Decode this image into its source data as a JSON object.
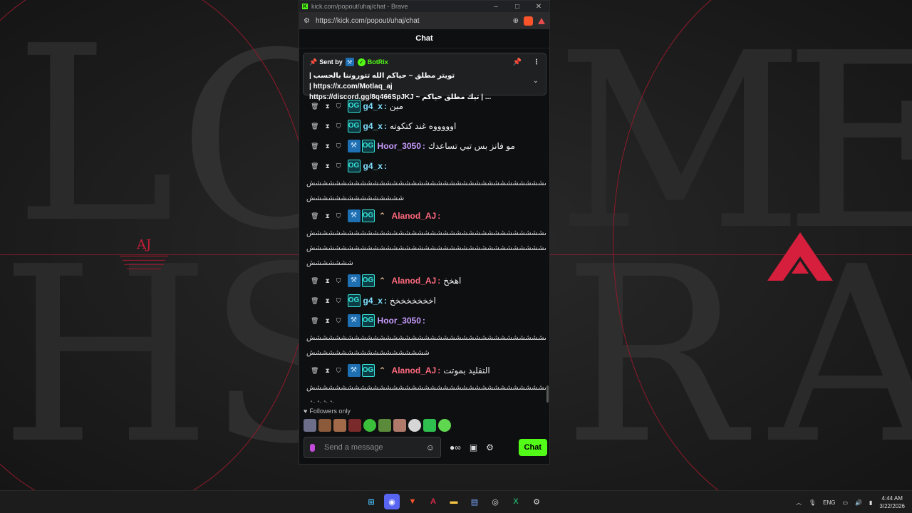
{
  "browser": {
    "title": "kick.com/popout/uhaj/chat - Brave",
    "url": "https://kick.com/popout/uhaj/chat"
  },
  "chat": {
    "header": "Chat",
    "pinned": {
      "sent_by_label": "Sent by",
      "sender": "BotRix",
      "line1": "تويتر مطلق ~ حياكم الله تتوروننا بالحسب | https://x.com/Motlaq_aj |",
      "line2": "https://discord.gg/8q466SpJKJ ~ تيك مطلق حياكم | ..."
    },
    "messages": [
      {
        "user": "g4_x",
        "color": "teal",
        "badges": [
          "vip"
        ],
        "text": "مين",
        "wrap": []
      },
      {
        "user": "g4_x",
        "color": "teal",
        "badges": [
          "vip"
        ],
        "text": "اوووووه غند كتكوته",
        "wrap": []
      },
      {
        "user": "Hoor_3050",
        "color": "purple",
        "badges": [
          "mod",
          "vip"
        ],
        "text": "مو فانز بس تبي تساعدك",
        "wrap": []
      },
      {
        "user": "g4_x",
        "color": "teal",
        "badges": [
          "vip"
        ],
        "text": "",
        "wrap": [
          "ششششششششششششششششششششششششششششششششششششششششششششششششش",
          "ششششششششششششششش"
        ]
      },
      {
        "user": "Alanod_AJ",
        "color": "pink",
        "badges": [
          "mod",
          "vip",
          "og"
        ],
        "text": "",
        "wrap": [
          "ششششششششششششششششششششششششششششششششششششششششششششششششش",
          "ششششششششششششششششششششششششششششششششششششششششششششششششش",
          "ششششششش"
        ]
      },
      {
        "user": "Alanod_AJ",
        "color": "pink",
        "badges": [
          "mod",
          "vip",
          "og"
        ],
        "text": "اهخخ",
        "wrap": []
      },
      {
        "user": "g4_x",
        "color": "teal",
        "badges": [
          "vip"
        ],
        "text": "اخخخخخخخخ",
        "wrap": []
      },
      {
        "user": "Hoor_3050",
        "color": "purple",
        "badges": [
          "mod",
          "vip"
        ],
        "text": "",
        "wrap": [
          "ششششششششششششششششششششششششششششششششششششششششششششششششش",
          "ششششششششششششششششششش"
        ]
      },
      {
        "user": "Alanod_AJ",
        "color": "pink",
        "badges": [
          "mod",
          "vip",
          "og"
        ],
        "text": "التقليد بموتت",
        "wrap": [
          "ششششششششششششششششششششششششششششششششششششششششششششششششش",
          "شششش"
        ]
      }
    ],
    "followers_only": "Followers only",
    "input_placeholder": "Send a message",
    "send_label": "Chat"
  },
  "wallpaper": {
    "text": "AJ"
  },
  "taskbar": {
    "lang": "ENG",
    "time": "4:44 AM",
    "date": "3/22/2026"
  },
  "colors": {
    "kick_green": "#53fc18",
    "teal": "#7fe0ff",
    "purple": "#c89cff",
    "pink": "#ff6a7f"
  }
}
